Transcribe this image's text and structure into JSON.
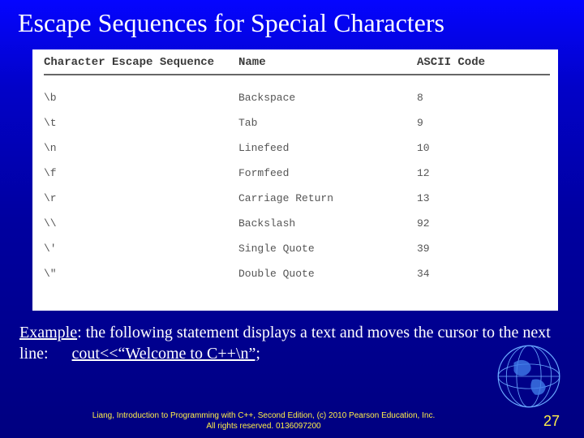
{
  "title": "Escape Sequences for Special Characters",
  "table": {
    "head": {
      "esc": "Character Escape Sequence",
      "name": "Name",
      "code": "ASCII Code"
    },
    "rows": [
      {
        "esc": "\\b",
        "name": "Backspace",
        "code": "8"
      },
      {
        "esc": "\\t",
        "name": "Tab",
        "code": "9"
      },
      {
        "esc": "\\n",
        "name": "Linefeed",
        "code": "10"
      },
      {
        "esc": "\\f",
        "name": "Formfeed",
        "code": "12"
      },
      {
        "esc": "\\r",
        "name": "Carriage Return",
        "code": "13"
      },
      {
        "esc": "\\\\",
        "name": "Backslash",
        "code": "92"
      },
      {
        "esc": "\\'",
        "name": "Single Quote",
        "code": "39"
      },
      {
        "esc": "\\\"",
        "name": "Double Quote",
        "code": "34"
      }
    ]
  },
  "example": {
    "label": "Example",
    "text1": ": the following statement displays a text and moves the cursor to the next line:",
    "code": "cout<<“Welcome to C++\\n”;"
  },
  "footer": {
    "line1": "Liang, Introduction to Programming with C++, Second Edition, (c) 2010 Pearson Education, Inc.",
    "line2": "All rights reserved. 0136097200"
  },
  "page": "27"
}
